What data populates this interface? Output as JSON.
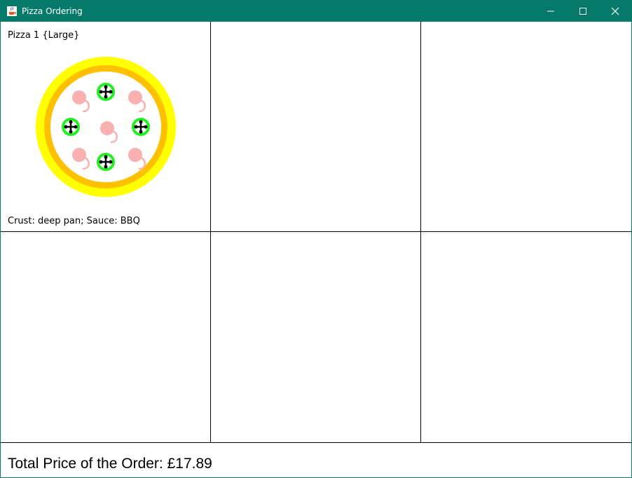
{
  "window": {
    "title": "Pizza Ordering",
    "icon": "java-cup-icon",
    "controls": [
      "minimize-icon",
      "maximize-icon",
      "close-icon"
    ]
  },
  "pizzas": [
    {
      "title": "Pizza 1 {Large}",
      "description": "Crust: deep pan; Sauce: BBQ",
      "toppings": [
        "shrimp",
        "olive-cross"
      ],
      "colors": {
        "crust_outer": "#ffff00",
        "crust_inner": "#ffc000",
        "base": "#ffffff",
        "shrimp": "#f8b0b0",
        "topping_ring": "#22ee22"
      }
    }
  ],
  "footer": {
    "total_label": "Total Price of the Order: £17.89"
  }
}
